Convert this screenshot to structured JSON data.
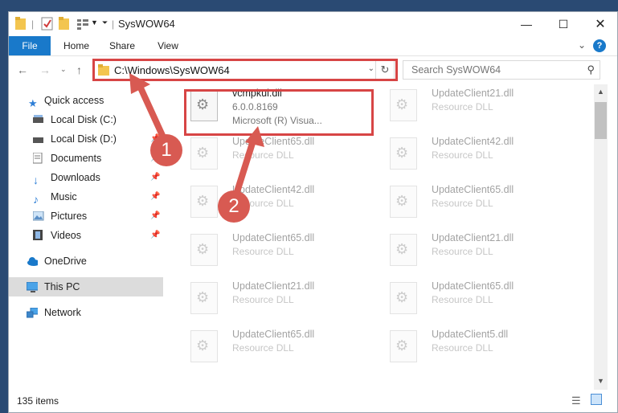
{
  "window": {
    "title": "SysWOW64",
    "minimize_icon": "minimize-icon",
    "maximize_icon": "maximize-icon",
    "close_icon": "close-icon"
  },
  "ribbon": {
    "tabs": [
      "File",
      "Home",
      "Share",
      "View"
    ]
  },
  "navbar": {
    "back_icon": "back-arrow-icon",
    "forward_icon": "forward-arrow-icon",
    "recent_icon": "chevron-down-icon",
    "up_icon": "up-arrow-icon",
    "address": "C:\\Windows\\SysWOW64",
    "search_placeholder": "Search SysWOW64"
  },
  "sidebar": {
    "items": [
      {
        "label": "Quick access",
        "icon": "star-icon",
        "pinned": false
      },
      {
        "label": "Local Disk (C:)",
        "icon": "drive-icon",
        "pinned": true
      },
      {
        "label": "Local Disk (D:)",
        "icon": "drive-icon",
        "pinned": true
      },
      {
        "label": "Documents",
        "icon": "documents-icon",
        "pinned": true
      },
      {
        "label": "Downloads",
        "icon": "downloads-icon",
        "pinned": true
      },
      {
        "label": "Music",
        "icon": "music-icon",
        "pinned": true
      },
      {
        "label": "Pictures",
        "icon": "pictures-icon",
        "pinned": true
      },
      {
        "label": "Videos",
        "icon": "videos-icon",
        "pinned": true
      },
      {
        "label": "OneDrive",
        "icon": "cloud-icon",
        "pinned": false
      },
      {
        "label": "This PC",
        "icon": "computer-icon",
        "pinned": false,
        "selected": true
      },
      {
        "label": "Network",
        "icon": "network-icon",
        "pinned": false
      }
    ]
  },
  "files": [
    {
      "name": "vcmpkui.dll",
      "line2": "6.0.0.8169",
      "line3": "Microsoft (R) Visua...",
      "highlighted": true
    },
    {
      "name": "UpdateClient21.dll",
      "line2": "Resource DLL"
    },
    {
      "name": "UpdateClient65.dll",
      "line2": "Resource DLL"
    },
    {
      "name": "UpdateClient42.dll",
      "line2": "Resource DLL"
    },
    {
      "name": "UpdateClient42.dll",
      "line2": "Resource DLL"
    },
    {
      "name": "UpdateClient65.dll",
      "line2": "Resource DLL"
    },
    {
      "name": "UpdateClient65.dll",
      "line2": "Resource DLL"
    },
    {
      "name": "UpdateClient21.dll",
      "line2": "Resource DLL"
    },
    {
      "name": "UpdateClient21.dll",
      "line2": "Resource DLL"
    },
    {
      "name": "UpdateClient65.dll",
      "line2": "Resource DLL"
    },
    {
      "name": "UpdateClient65.dll",
      "line2": "Resource DLL"
    },
    {
      "name": "UpdateClient5.dll",
      "line2": "Resource DLL"
    }
  ],
  "status": {
    "item_count": "135 items"
  },
  "annotations": {
    "step1": "1",
    "step2": "2",
    "color": "#d74545"
  }
}
